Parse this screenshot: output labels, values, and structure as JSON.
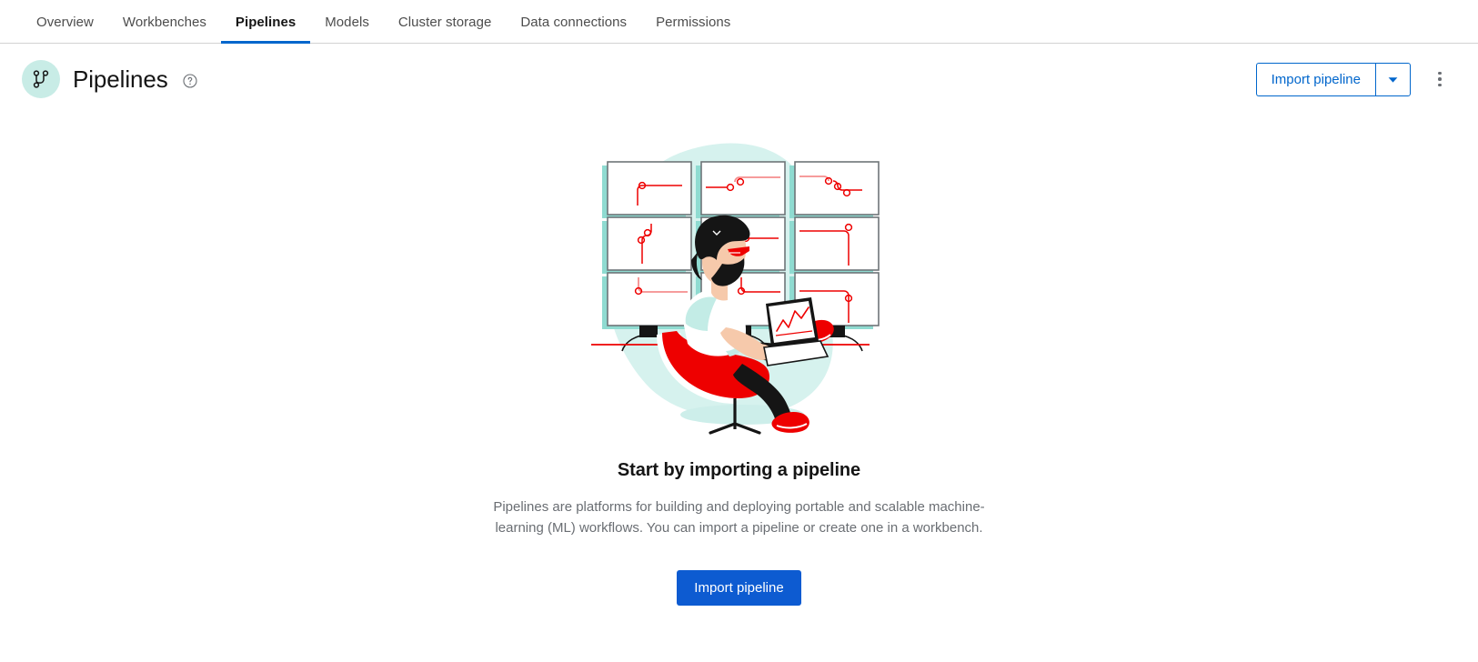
{
  "tabs": [
    {
      "label": "Overview",
      "active": false
    },
    {
      "label": "Workbenches",
      "active": false
    },
    {
      "label": "Pipelines",
      "active": true
    },
    {
      "label": "Models",
      "active": false
    },
    {
      "label": "Cluster storage",
      "active": false
    },
    {
      "label": "Data connections",
      "active": false
    },
    {
      "label": "Permissions",
      "active": false
    }
  ],
  "header": {
    "title": "Pipelines",
    "title_icon": "pipeline-branch-icon",
    "help_icon": "question-circle-icon",
    "import_button_label": "Import pipeline",
    "dropdown_icon": "caret-down-icon",
    "kebab_icon": "kebab-vertical-icon"
  },
  "empty_state": {
    "illustration_name": "person-at-monitors-illustration",
    "title": "Start by importing a pipeline",
    "body": "Pipelines are platforms for building and deploying portable and scalable machine-learning (ML) workflows. You can import a pipeline or create one in a workbench.",
    "action_label": "Import pipeline"
  },
  "colors": {
    "accent_blue": "#0066cc",
    "primary_button": "#0d5bd1",
    "icon_bg_teal": "#c8ece6",
    "illustration_red": "#ee0000",
    "illustration_teal": "#8fdbd1",
    "illustration_blob": "#d6f2ee",
    "text_default": "#151515",
    "text_muted": "#6a6e73",
    "border": "#d2d2d2"
  }
}
